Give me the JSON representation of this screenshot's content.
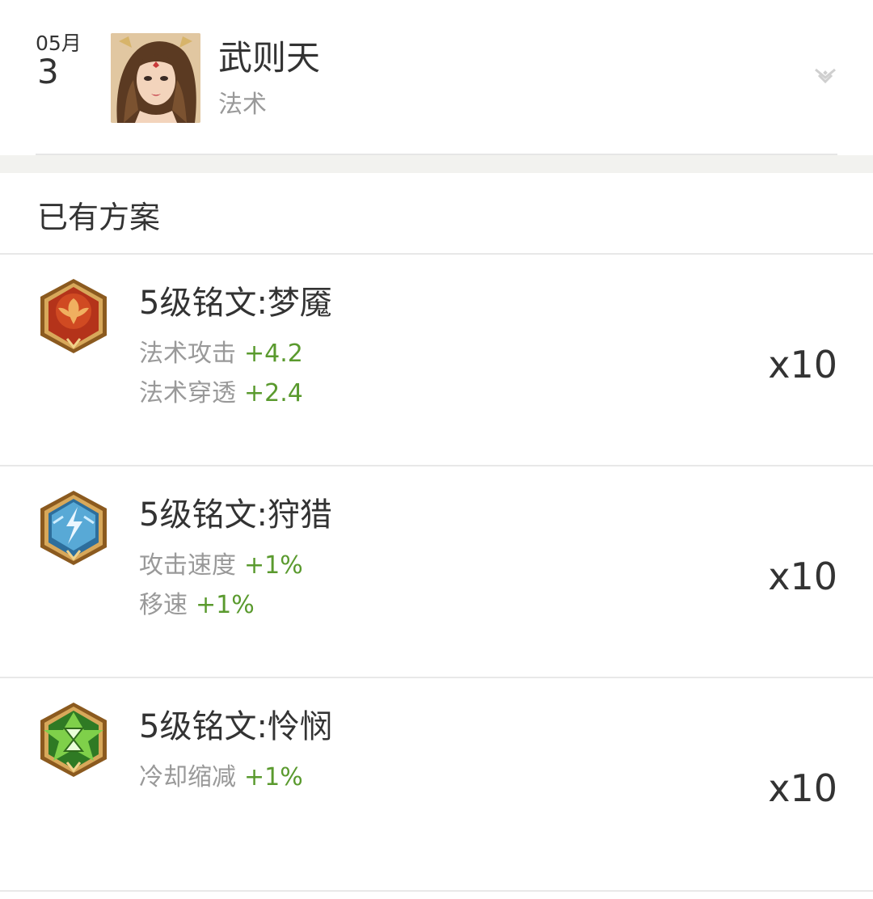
{
  "header": {
    "month": "05月",
    "day": "3",
    "hero_name": "武则天",
    "hero_role": "法术",
    "expand_icon": "double-chevron-down-icon"
  },
  "section": {
    "title": "已有方案"
  },
  "runes": [
    {
      "title": "5级铭文:梦魇",
      "icon": "red-rune-icon",
      "color": "#c8421c",
      "stats": [
        {
          "name": "法术攻击",
          "value": "+4.2"
        },
        {
          "name": "法术穿透",
          "value": "+2.4"
        }
      ],
      "count": "x10"
    },
    {
      "title": "5级铭文:狩猎",
      "icon": "blue-rune-icon",
      "color": "#3f8fc7",
      "stats": [
        {
          "name": "攻击速度",
          "value": "+1%"
        },
        {
          "name": "移速",
          "value": "+1%"
        }
      ],
      "count": "x10"
    },
    {
      "title": "5级铭文:怜悯",
      "icon": "green-rune-icon",
      "color": "#5fae2a",
      "stats": [
        {
          "name": "冷却缩减",
          "value": "+1%"
        }
      ],
      "count": "x10"
    }
  ]
}
